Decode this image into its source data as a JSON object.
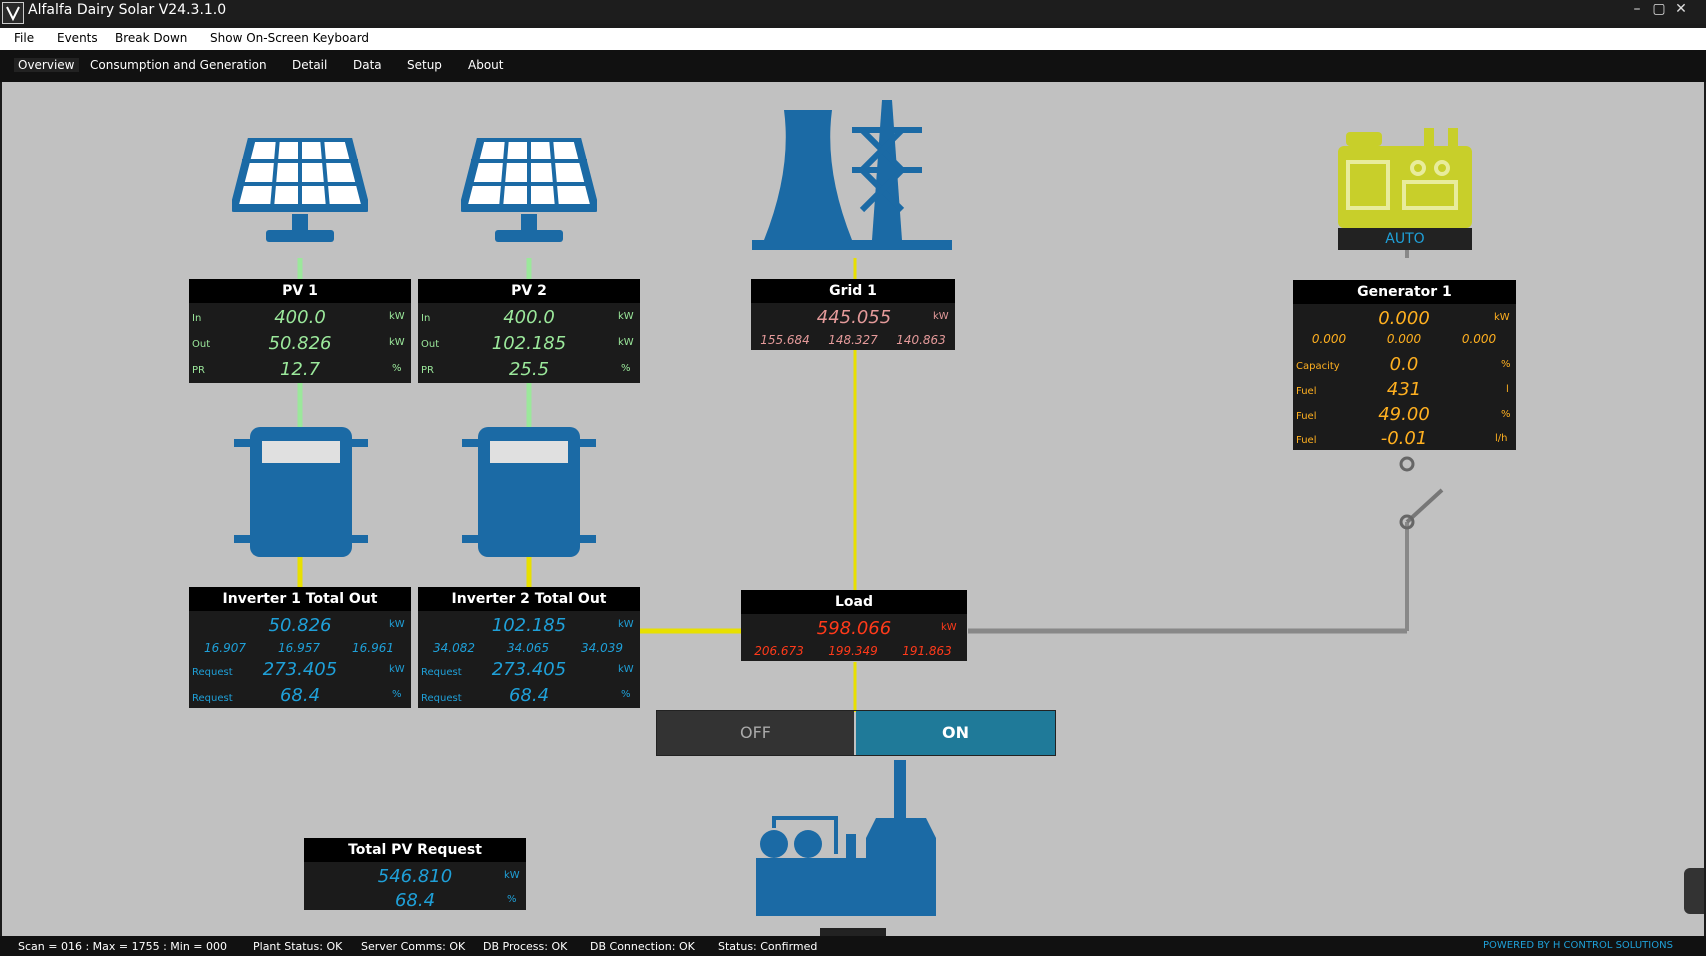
{
  "window": {
    "title": "Alfalfa Dairy Solar V24.3.1.0"
  },
  "menu": [
    "File",
    "Events",
    "Break Down",
    "Show On-Screen Keyboard"
  ],
  "tabs": [
    "Overview",
    "Consumption and Generation",
    "Detail",
    "Data",
    "Setup",
    "About"
  ],
  "pv1": {
    "title": "PV 1",
    "rows": [
      {
        "label": "In",
        "value": "400.0",
        "unit": "kW"
      },
      {
        "label": "Out",
        "value": "50.826",
        "unit": "kW"
      },
      {
        "label": "PR",
        "value": "12.7",
        "unit": "%"
      }
    ]
  },
  "pv2": {
    "title": "PV 2",
    "rows": [
      {
        "label": "In",
        "value": "400.0",
        "unit": "kW"
      },
      {
        "label": "Out",
        "value": "102.185",
        "unit": "kW"
      },
      {
        "label": "PR",
        "value": "25.5",
        "unit": "%"
      }
    ]
  },
  "inv1": {
    "title": "Inverter 1 Total Out",
    "total": "50.826",
    "unit": "kW",
    "phases": [
      "16.907",
      "16.957",
      "16.961"
    ],
    "req_label": "Request",
    "req_kw": "273.405",
    "req_kw_unit": "kW",
    "req_pct": "68.4",
    "req_pct_unit": "%"
  },
  "inv2": {
    "title": "Inverter 2 Total Out",
    "total": "102.185",
    "unit": "kW",
    "phases": [
      "34.082",
      "34.065",
      "34.039"
    ],
    "req_label": "Request",
    "req_kw": "273.405",
    "req_kw_unit": "kW",
    "req_pct": "68.4",
    "req_pct_unit": "%"
  },
  "grid": {
    "title": "Grid 1",
    "value": "445.055",
    "unit": "kW",
    "phases": [
      "155.684",
      "148.327",
      "140.863"
    ]
  },
  "load": {
    "title": "Load",
    "value": "598.066",
    "unit": "kW",
    "phases": [
      "206.673",
      "199.349",
      "191.863"
    ]
  },
  "generator": {
    "title": "Generator 1",
    "mode": "AUTO",
    "power": "0.000",
    "power_unit": "kW",
    "phases": [
      "0.000",
      "0.000",
      "0.000"
    ],
    "rows": [
      {
        "label": "Capacity",
        "value": "0.0",
        "unit": "%"
      },
      {
        "label": "Fuel",
        "value": "431",
        "unit": "l"
      },
      {
        "label": "Fuel",
        "value": "49.00",
        "unit": "%"
      },
      {
        "label": "Fuel",
        "value": "-0.01",
        "unit": "l/h"
      }
    ]
  },
  "total_pv": {
    "title": "Total PV Request",
    "kw": "546.810",
    "kw_unit": "kW",
    "pct": "68.4",
    "pct_unit": "%"
  },
  "toggle": {
    "off": "OFF",
    "on": "ON",
    "state": "ON"
  },
  "status": {
    "scan": "Scan = 016 : Max = 1755 : Min = 000",
    "plant": "Plant Status: OK",
    "server": "Server Comms: OK",
    "dbproc": "DB Process:  OK",
    "dbconn": "DB Connection:  OK",
    "status": "Status:  Confirmed",
    "powered": "POWERED BY H CONTROL SOLUTIONS"
  },
  "colors": {
    "pv_green": "#9be89b",
    "inv_blue": "#1fa0d8",
    "grid_pink": "#e49a9a",
    "load_red": "#ff3a1a",
    "gen_orange": "#ffb020",
    "icon_blue": "#1b6aa5",
    "gen_yellow": "#c8cf2a"
  }
}
